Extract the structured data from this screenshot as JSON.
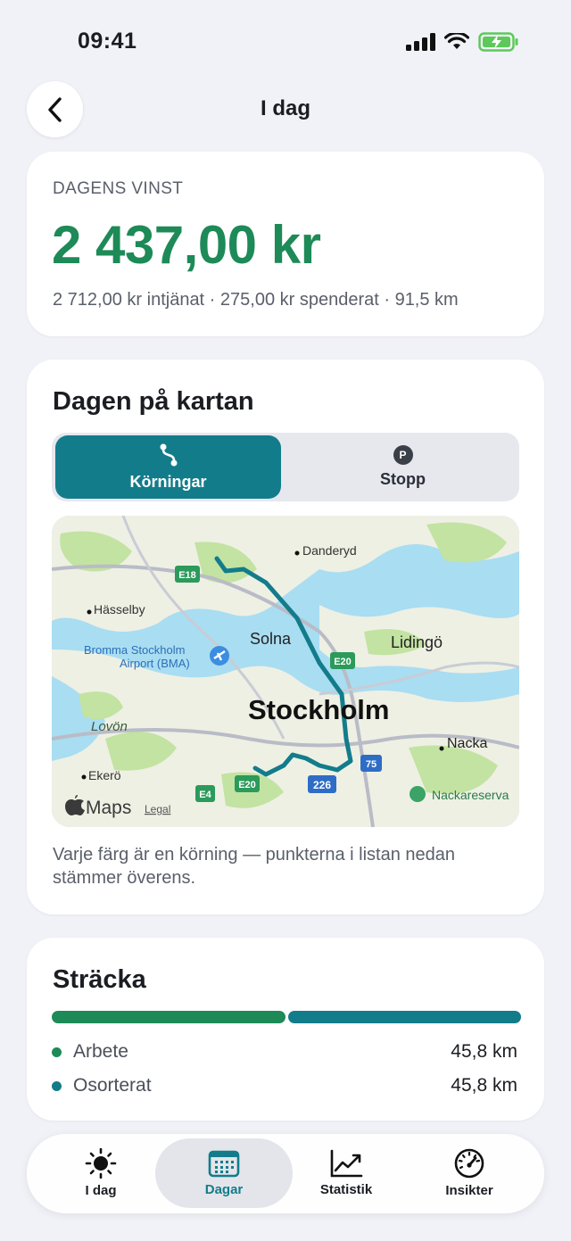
{
  "status_bar": {
    "time": "09:41"
  },
  "nav": {
    "title": "I dag"
  },
  "summary": {
    "kicker": "DAGENS VINST",
    "profit": "2 437,00 kr",
    "details": "2 712,00 kr intjänat · 275,00 kr spenderat · 91,5 km"
  },
  "map_card": {
    "title": "Dagen på kartan",
    "segments": [
      {
        "label": "Körningar",
        "icon": "route-icon",
        "selected": true
      },
      {
        "label": "Stopp",
        "icon": "parking-icon",
        "selected": false
      }
    ],
    "map": {
      "labels": {
        "danderyd": "Danderyd",
        "hasselby": "Hässelby",
        "solna": "Solna",
        "lidingo": "Lidingö",
        "bromma": "Bromma Stockholm",
        "bromma2": "Airport (BMA)",
        "stockholm": "Stockholm",
        "lovon": "Lovön",
        "nacka": "Nacka",
        "ekero": "Ekerö",
        "nackareserv": "Nackareserva",
        "attribution": "Maps",
        "legal": "Legal"
      },
      "road_shields": {
        "e18": "E18",
        "e20a": "E20",
        "e20b": "E20",
        "e4": "E4",
        "r75": "75",
        "r226": "226"
      }
    },
    "caption": "Varje färg är en körning — punkterna i listan nedan stämmer överens."
  },
  "distance": {
    "title": "Sträcka",
    "categories": [
      {
        "label": "Arbete",
        "value": "45,8 km",
        "km": 45.8,
        "color": "#1d8a57"
      },
      {
        "label": "Osorterat",
        "value": "45,8 km",
        "km": 45.8,
        "color": "#137c8b"
      }
    ]
  },
  "tabbar": {
    "tabs": [
      {
        "label": "I dag",
        "icon": "sun-icon"
      },
      {
        "label": "Dagar",
        "icon": "calendar-icon",
        "active": true
      },
      {
        "label": "Statistik",
        "icon": "chart-icon"
      },
      {
        "label": "Insikter",
        "icon": "gauge-icon"
      }
    ]
  },
  "colors": {
    "accent": "#137c8b",
    "profit": "#1d8a57",
    "background": "#f1f2f7"
  }
}
